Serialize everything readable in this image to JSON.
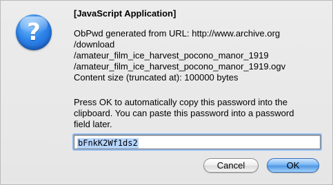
{
  "dialog": {
    "title": "[JavaScript Application]",
    "icon": "question-mark-icon",
    "icon_glyph": "?",
    "message_lines": [
      "ObPwd generated from URL: http://www.archive.org",
      "/download",
      "/amateur_film_ice_harvest_pocono_manor_1919",
      "/amateur_film_ice_harvest_pocono_manor_1919.ogv",
      "Content size (truncated at): 100000 bytes"
    ],
    "instruction_lines": [
      "Press OK to automatically copy this password into the",
      "clipboard. You can paste this password into a password",
      "field later."
    ],
    "password_value": "bFnkK2Wf1ds2",
    "buttons": {
      "cancel_label": "Cancel",
      "ok_label": "OK"
    }
  },
  "colors": {
    "icon_blue": "#2f86ea",
    "default_button": "#4f97e3",
    "selection": "#b5d5ff"
  }
}
